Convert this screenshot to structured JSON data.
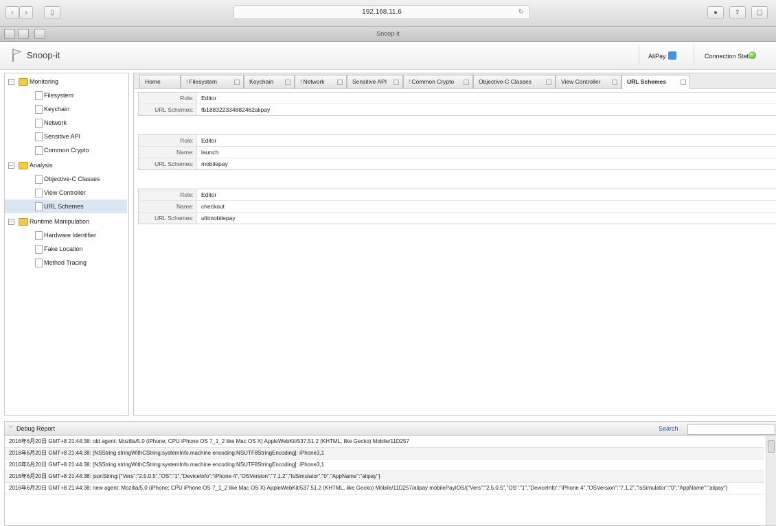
{
  "browser": {
    "address": "192.168.11.6",
    "window_title": "Snoop-it"
  },
  "app": {
    "title": "Snoop-it",
    "app_label": "AliPay",
    "connection_label": "Connection Status",
    "colors": {
      "connected": "#3da512",
      "selected_row": "#dbe6f4",
      "folder": "#f1c950"
    }
  },
  "sidebar": {
    "sections": [
      {
        "label": "Monitoring",
        "items": [
          "Filesystem",
          "Keychain",
          "Network",
          "Sensitive API",
          "Common Crypto"
        ]
      },
      {
        "label": "Analysis",
        "items": [
          "Objective-C Classes",
          "View Controller",
          "URL Schemes"
        ]
      },
      {
        "label": "Runtime Manipulation",
        "items": [
          "Hardware Identifier",
          "Fake Location",
          "Method Tracing"
        ]
      }
    ],
    "selected": "URL Schemes"
  },
  "tabs": [
    {
      "label": "Home",
      "flag": ""
    },
    {
      "label": "Filesystem",
      "flag": "!"
    },
    {
      "label": "Keychain",
      "flag": ""
    },
    {
      "label": "Network",
      "flag": "!"
    },
    {
      "label": "Sensitive API",
      "flag": ""
    },
    {
      "label": "Common Crypto",
      "flag": "!"
    },
    {
      "label": "Objective-C Classes",
      "flag": ""
    },
    {
      "label": "View Controller",
      "flag": ""
    },
    {
      "label": "URL Schemes",
      "flag": ""
    }
  ],
  "active_tab": "URL Schemes",
  "schemes": [
    {
      "role_label": "Role:",
      "role": "Editor",
      "name_label": "",
      "name": "",
      "schemes_label": "URL Schemes:",
      "schemes": "fb188322334882462alipay"
    },
    {
      "role_label": "Role:",
      "role": "Editor",
      "name_label": "Name:",
      "name": "launch",
      "schemes_label": "URL Schemes:",
      "schemes": "mobilepay"
    },
    {
      "role_label": "Role:",
      "role": "Editor",
      "name_label": "Name:",
      "name": "checkout",
      "schemes_label": "URL Schemes:",
      "schemes": "ultimobilepay"
    }
  ],
  "debug": {
    "title": "Debug Report",
    "search_label": "Search",
    "search_value": "",
    "lines": [
      "2016年6月20日 GMT+8 21:44:38: old agent: Mozilla/5.0 (iPhone; CPU iPhone OS 7_1_2 like Mac OS X) AppleWebKit/537.51.2 (KHTML, like Gecko) Mobile/11D257",
      "2016年6月20日 GMT+8 21:44:38: [NSString stringWithCString:systemInfo.machine encoding:NSUTF8StringEncoding]: iPhone3,1",
      "2016年6月20日 GMT+8 21:44:38: [NSString stringWithCString:systemInfo.machine encoding:NSUTF8StringEncoding]: iPhone3,1",
      "2016年6月20日 GMT+8 21:44:38: jsonString:{\"Vers\":\"2.5.0.5\",\"OS\":\"1\",\"DeviceInfo\":\"iPhone 4\",\"OSVersion\":\"7.1.2\",\"IsSimulator\":\"0\",\"AppName\":\"alipay\"}",
      "2016年6月20日 GMT+8 21:44:38: new agent: Mozilla/5.0 (iPhone; CPU iPhone OS 7_1_2 like Mac OS X) AppleWebKit/537.51.2 (KHTML, like Gecko) Mobile/11D257/alipay mobilePayIOS/{\"Vers\":\"2.5.0.5\",\"OS\":\"1\",\"DeviceInfo\":\"iPhone 4\",\"OSVersion\":\"7.1.2\",\"IsSimulator\":\"0\",\"AppName\":\"alipay\"}"
    ]
  }
}
